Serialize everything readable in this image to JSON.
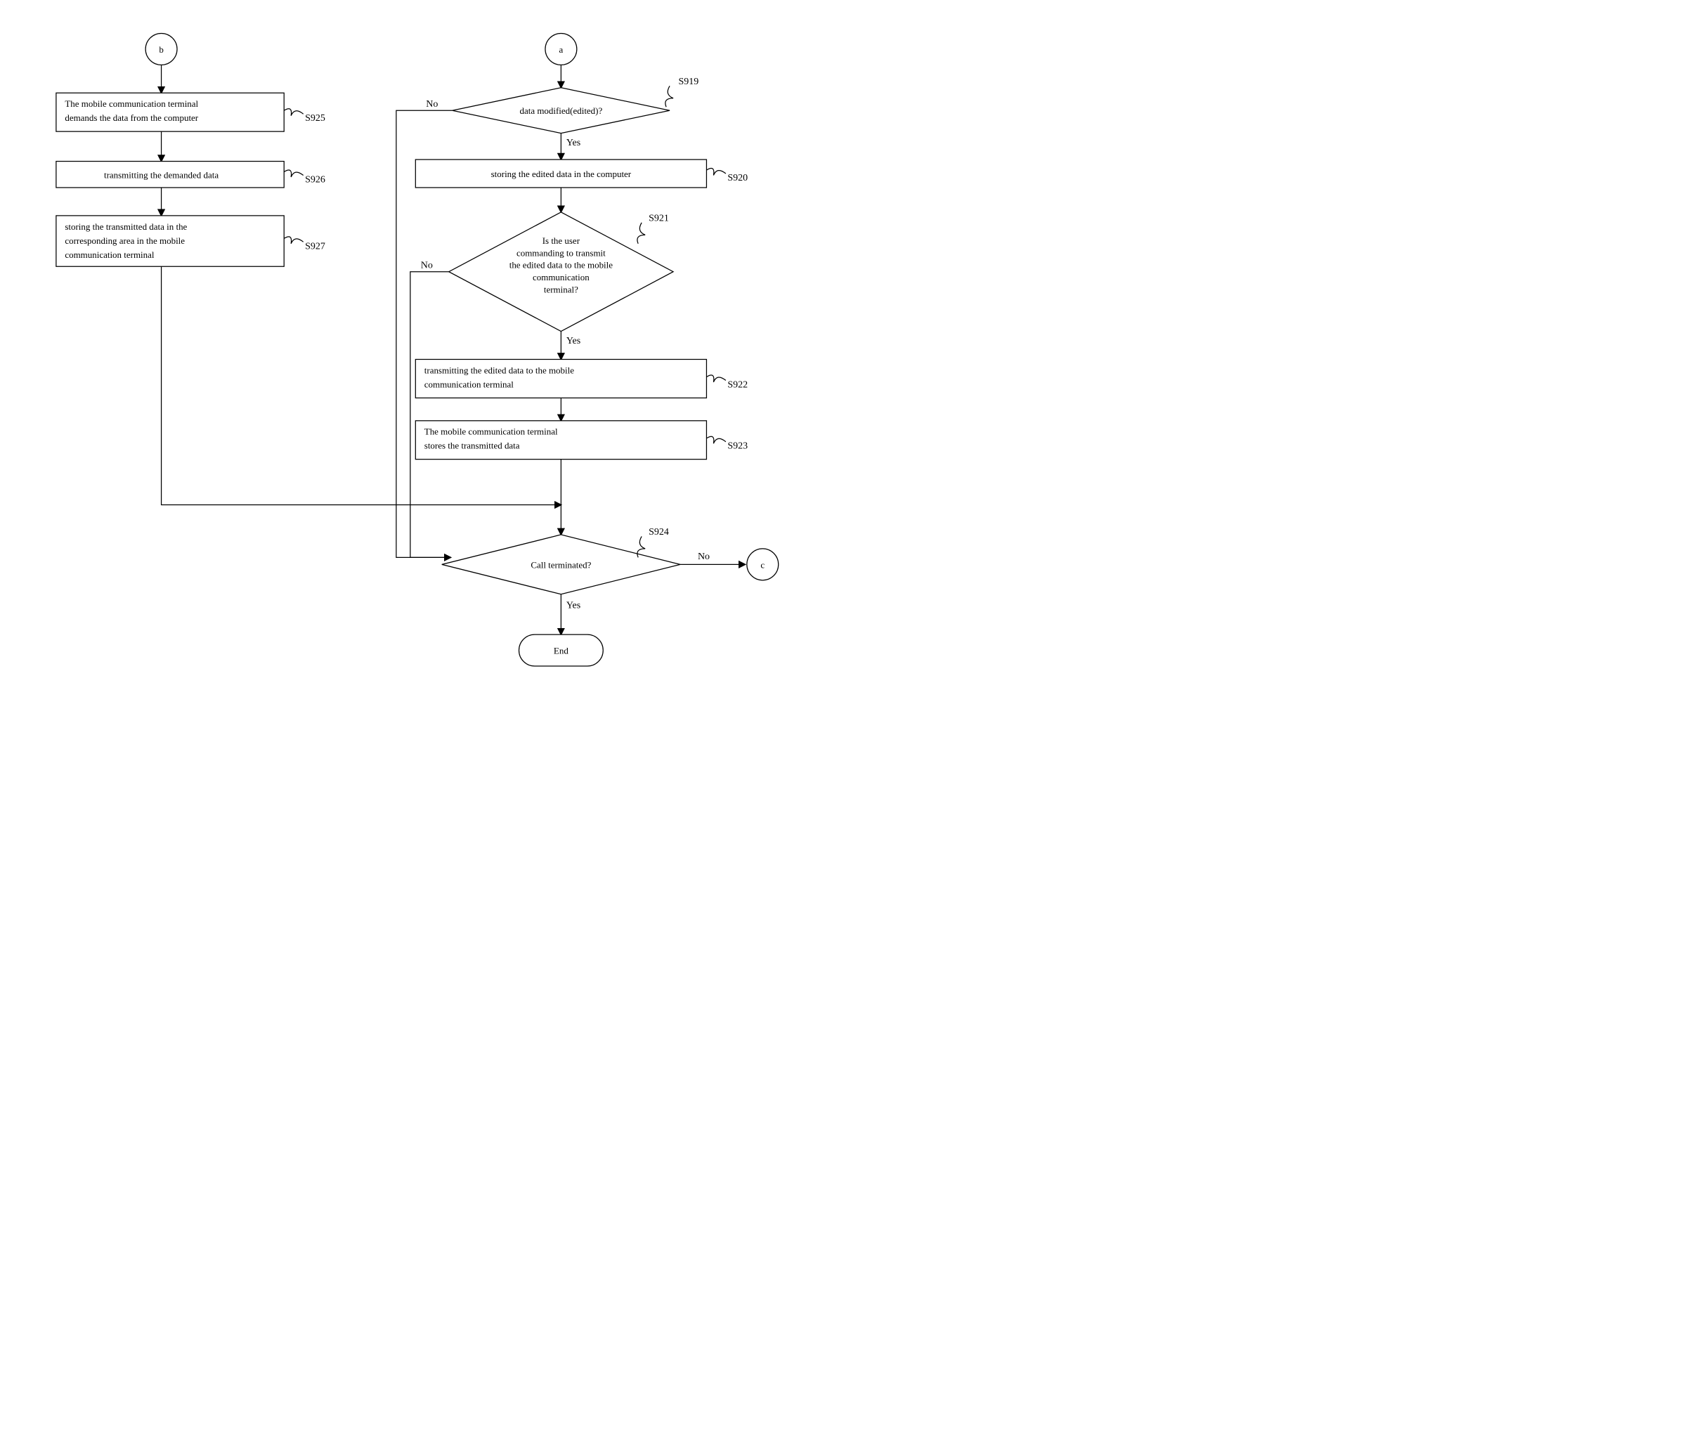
{
  "connectors": {
    "a": "a",
    "b": "b",
    "c": "c"
  },
  "terminator": {
    "end": "End"
  },
  "decisions": {
    "d919": "data modified(edited)?",
    "d921_l1": "Is the user",
    "d921_l2": "commanding to transmit",
    "d921_l3": "the edited data to the mobile",
    "d921_l4": "communication",
    "d921_l5": "terminal?",
    "d924": "Call terminated?"
  },
  "processes": {
    "s925_l1": "The mobile communication terminal",
    "s925_l2": "demands the data from the computer",
    "s926": "transmitting the demanded data",
    "s927_l1": "storing the transmitted data in the",
    "s927_l2": "corresponding area in the mobile",
    "s927_l3": "communication terminal",
    "s920": "storing the edited data in the computer",
    "s922_l1": "transmitting the edited data to the mobile",
    "s922_l2": "communication terminal",
    "s923_l1": "The mobile communication terminal",
    "s923_l2": "stores the transmitted data"
  },
  "labels": {
    "yes": "Yes",
    "no": "No",
    "s919": "S919",
    "s920": "S920",
    "s921": "S921",
    "s922": "S922",
    "s923": "S923",
    "s924": "S924",
    "s925": "S925",
    "s926": "S926",
    "s927": "S927"
  }
}
